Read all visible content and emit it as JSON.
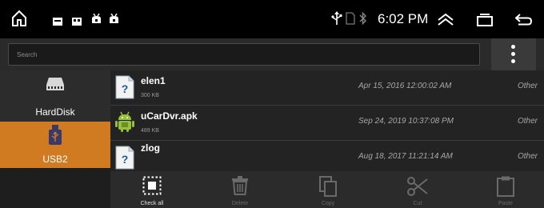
{
  "status_bar": {
    "time": "6:02 PM",
    "left_icons": [
      "home-icon",
      "notification-icon",
      "notification-icon",
      "android-debug-icon",
      "android-debug-icon"
    ],
    "right_icons": [
      "usb-icon",
      "sim-icon",
      "bluetooth-icon",
      "expand-icon",
      "recent-apps-icon",
      "back-icon"
    ]
  },
  "search": {
    "placeholder": "Search"
  },
  "sidebar": {
    "drives": [
      {
        "label": "HardDisk",
        "icon": "hard-disk-icon",
        "selected": false
      },
      {
        "label": "USB2",
        "icon": "usb-icon",
        "selected": true
      }
    ]
  },
  "files": [
    {
      "name": "elen1",
      "size": "300 KB",
      "date": "Apr 15, 2016 12:00:02 AM",
      "type": "Other",
      "icon": "unknown-file-icon"
    },
    {
      "name": "uCarDvr.apk",
      "size": "489 KB",
      "date": "Sep 24, 2019 10:37:08 PM",
      "type": "Other",
      "icon": "android-apk-icon"
    },
    {
      "name": "zlog",
      "size": "",
      "date": "Aug 18, 2017 11:21:14 AM",
      "type": "Other",
      "icon": "unknown-file-icon"
    }
  ],
  "toolbar": {
    "check_all": "Check all",
    "delete": "Delete",
    "copy": "Copy",
    "cut": "Cut",
    "paste": "Paste"
  },
  "colors": {
    "accent": "#d07a22",
    "background": "#232323"
  }
}
